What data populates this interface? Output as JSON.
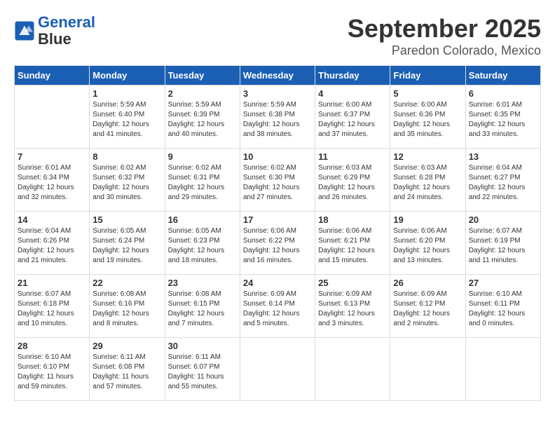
{
  "header": {
    "logo_line1": "General",
    "logo_line2": "Blue",
    "month": "September 2025",
    "location": "Paredon Colorado, Mexico"
  },
  "weekdays": [
    "Sunday",
    "Monday",
    "Tuesday",
    "Wednesday",
    "Thursday",
    "Friday",
    "Saturday"
  ],
  "weeks": [
    [
      {
        "day": "",
        "sunrise": "",
        "sunset": "",
        "daylight": ""
      },
      {
        "day": "1",
        "sunrise": "Sunrise: 5:59 AM",
        "sunset": "Sunset: 6:40 PM",
        "daylight": "Daylight: 12 hours and 41 minutes."
      },
      {
        "day": "2",
        "sunrise": "Sunrise: 5:59 AM",
        "sunset": "Sunset: 6:39 PM",
        "daylight": "Daylight: 12 hours and 40 minutes."
      },
      {
        "day": "3",
        "sunrise": "Sunrise: 5:59 AM",
        "sunset": "Sunset: 6:38 PM",
        "daylight": "Daylight: 12 hours and 38 minutes."
      },
      {
        "day": "4",
        "sunrise": "Sunrise: 6:00 AM",
        "sunset": "Sunset: 6:37 PM",
        "daylight": "Daylight: 12 hours and 37 minutes."
      },
      {
        "day": "5",
        "sunrise": "Sunrise: 6:00 AM",
        "sunset": "Sunset: 6:36 PM",
        "daylight": "Daylight: 12 hours and 35 minutes."
      },
      {
        "day": "6",
        "sunrise": "Sunrise: 6:01 AM",
        "sunset": "Sunset: 6:35 PM",
        "daylight": "Daylight: 12 hours and 33 minutes."
      }
    ],
    [
      {
        "day": "7",
        "sunrise": "Sunrise: 6:01 AM",
        "sunset": "Sunset: 6:34 PM",
        "daylight": "Daylight: 12 hours and 32 minutes."
      },
      {
        "day": "8",
        "sunrise": "Sunrise: 6:02 AM",
        "sunset": "Sunset: 6:32 PM",
        "daylight": "Daylight: 12 hours and 30 minutes."
      },
      {
        "day": "9",
        "sunrise": "Sunrise: 6:02 AM",
        "sunset": "Sunset: 6:31 PM",
        "daylight": "Daylight: 12 hours and 29 minutes."
      },
      {
        "day": "10",
        "sunrise": "Sunrise: 6:02 AM",
        "sunset": "Sunset: 6:30 PM",
        "daylight": "Daylight: 12 hours and 27 minutes."
      },
      {
        "day": "11",
        "sunrise": "Sunrise: 6:03 AM",
        "sunset": "Sunset: 6:29 PM",
        "daylight": "Daylight: 12 hours and 26 minutes."
      },
      {
        "day": "12",
        "sunrise": "Sunrise: 6:03 AM",
        "sunset": "Sunset: 6:28 PM",
        "daylight": "Daylight: 12 hours and 24 minutes."
      },
      {
        "day": "13",
        "sunrise": "Sunrise: 6:04 AM",
        "sunset": "Sunset: 6:27 PM",
        "daylight": "Daylight: 12 hours and 22 minutes."
      }
    ],
    [
      {
        "day": "14",
        "sunrise": "Sunrise: 6:04 AM",
        "sunset": "Sunset: 6:26 PM",
        "daylight": "Daylight: 12 hours and 21 minutes."
      },
      {
        "day": "15",
        "sunrise": "Sunrise: 6:05 AM",
        "sunset": "Sunset: 6:24 PM",
        "daylight": "Daylight: 12 hours and 19 minutes."
      },
      {
        "day": "16",
        "sunrise": "Sunrise: 6:05 AM",
        "sunset": "Sunset: 6:23 PM",
        "daylight": "Daylight: 12 hours and 18 minutes."
      },
      {
        "day": "17",
        "sunrise": "Sunrise: 6:06 AM",
        "sunset": "Sunset: 6:22 PM",
        "daylight": "Daylight: 12 hours and 16 minutes."
      },
      {
        "day": "18",
        "sunrise": "Sunrise: 6:06 AM",
        "sunset": "Sunset: 6:21 PM",
        "daylight": "Daylight: 12 hours and 15 minutes."
      },
      {
        "day": "19",
        "sunrise": "Sunrise: 6:06 AM",
        "sunset": "Sunset: 6:20 PM",
        "daylight": "Daylight: 12 hours and 13 minutes."
      },
      {
        "day": "20",
        "sunrise": "Sunrise: 6:07 AM",
        "sunset": "Sunset: 6:19 PM",
        "daylight": "Daylight: 12 hours and 11 minutes."
      }
    ],
    [
      {
        "day": "21",
        "sunrise": "Sunrise: 6:07 AM",
        "sunset": "Sunset: 6:18 PM",
        "daylight": "Daylight: 12 hours and 10 minutes."
      },
      {
        "day": "22",
        "sunrise": "Sunrise: 6:08 AM",
        "sunset": "Sunset: 6:16 PM",
        "daylight": "Daylight: 12 hours and 8 minutes."
      },
      {
        "day": "23",
        "sunrise": "Sunrise: 6:08 AM",
        "sunset": "Sunset: 6:15 PM",
        "daylight": "Daylight: 12 hours and 7 minutes."
      },
      {
        "day": "24",
        "sunrise": "Sunrise: 6:09 AM",
        "sunset": "Sunset: 6:14 PM",
        "daylight": "Daylight: 12 hours and 5 minutes."
      },
      {
        "day": "25",
        "sunrise": "Sunrise: 6:09 AM",
        "sunset": "Sunset: 6:13 PM",
        "daylight": "Daylight: 12 hours and 3 minutes."
      },
      {
        "day": "26",
        "sunrise": "Sunrise: 6:09 AM",
        "sunset": "Sunset: 6:12 PM",
        "daylight": "Daylight: 12 hours and 2 minutes."
      },
      {
        "day": "27",
        "sunrise": "Sunrise: 6:10 AM",
        "sunset": "Sunset: 6:11 PM",
        "daylight": "Daylight: 12 hours and 0 minutes."
      }
    ],
    [
      {
        "day": "28",
        "sunrise": "Sunrise: 6:10 AM",
        "sunset": "Sunset: 6:10 PM",
        "daylight": "Daylight: 11 hours and 59 minutes."
      },
      {
        "day": "29",
        "sunrise": "Sunrise: 6:11 AM",
        "sunset": "Sunset: 6:08 PM",
        "daylight": "Daylight: 11 hours and 57 minutes."
      },
      {
        "day": "30",
        "sunrise": "Sunrise: 6:11 AM",
        "sunset": "Sunset: 6:07 PM",
        "daylight": "Daylight: 11 hours and 55 minutes."
      },
      {
        "day": "",
        "sunrise": "",
        "sunset": "",
        "daylight": ""
      },
      {
        "day": "",
        "sunrise": "",
        "sunset": "",
        "daylight": ""
      },
      {
        "day": "",
        "sunrise": "",
        "sunset": "",
        "daylight": ""
      },
      {
        "day": "",
        "sunrise": "",
        "sunset": "",
        "daylight": ""
      }
    ]
  ]
}
